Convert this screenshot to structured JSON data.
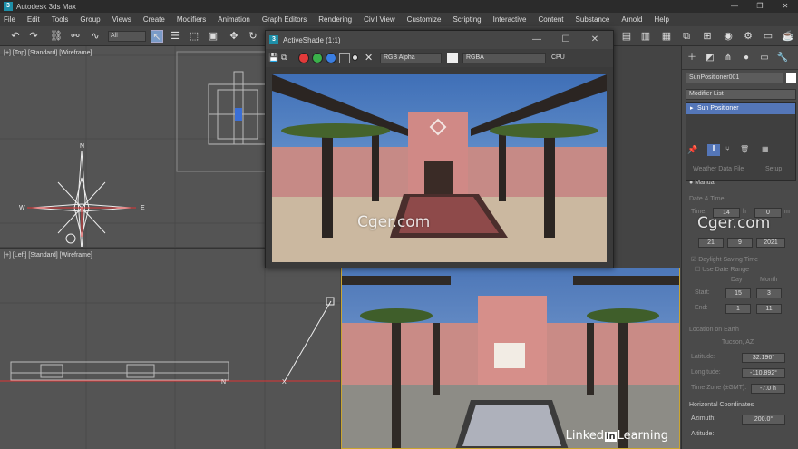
{
  "app": {
    "title": "Autodesk 3ds Max",
    "icon": "3ds-max-icon"
  },
  "menu": [
    "File",
    "Edit",
    "Tools",
    "Group",
    "Views",
    "Create",
    "Modifiers",
    "Animation",
    "Graph Editors",
    "Rendering",
    "Civil View",
    "Customize",
    "Scripting",
    "Interactive",
    "Content",
    "Substance",
    "Arnold",
    "Help"
  ],
  "toolbar": {
    "selection_filter": "All"
  },
  "viewports": {
    "top": "[+] [Top] [Standard] [Wireframe]",
    "left": "[+] [Left] [Standard] [Wireframe]"
  },
  "activeshade": {
    "title": "ActiveShade (1:1)",
    "channel": "RGB Alpha",
    "display": "RGBA",
    "device": "CPU"
  },
  "watermark": "Cger.com",
  "command_panel": {
    "object_name": "SunPositioner001",
    "modifier_list": "Modifier List",
    "stack_item": "Sun Positioner",
    "weather_label": "Weather Data File",
    "setup_label": "Setup",
    "manual_label": "Manual",
    "date_time_label": "Date & Time",
    "time_label": "Time:",
    "hour": "14",
    "hour_unit": "h",
    "minute": "0",
    "minute_unit": "m",
    "date_d": "21",
    "date_m": "9",
    "date_y": "2021",
    "dst_label": "Daylight Saving Time",
    "use_date_range": "Use Date Range",
    "day_col": "Day",
    "month_col": "Month",
    "start_label": "Start:",
    "start_day": "15",
    "start_month": "3",
    "end_label": "End:",
    "end_day": "1",
    "end_month": "11",
    "location_label": "Location on Earth",
    "city": "Tucson, AZ",
    "latitude_label": "Latitude:",
    "latitude": "32.196°",
    "longitude_label": "Longitude:",
    "longitude": "-110.892°",
    "timezone_label": "Time Zone (±GMT):",
    "timezone": "-7.0 h",
    "horiz_label": "Horizontal Coordinates",
    "azimuth_label": "Azimuth:",
    "azimuth": "200.0°",
    "altitude_label": "Altitude:"
  },
  "branding": {
    "prefix": "Linked",
    "in": "in",
    "suffix": "Learning"
  },
  "compass": {
    "n": "N",
    "e": "E",
    "w": "W"
  },
  "left_vp_labels": {
    "n": "N",
    "x": "X"
  }
}
